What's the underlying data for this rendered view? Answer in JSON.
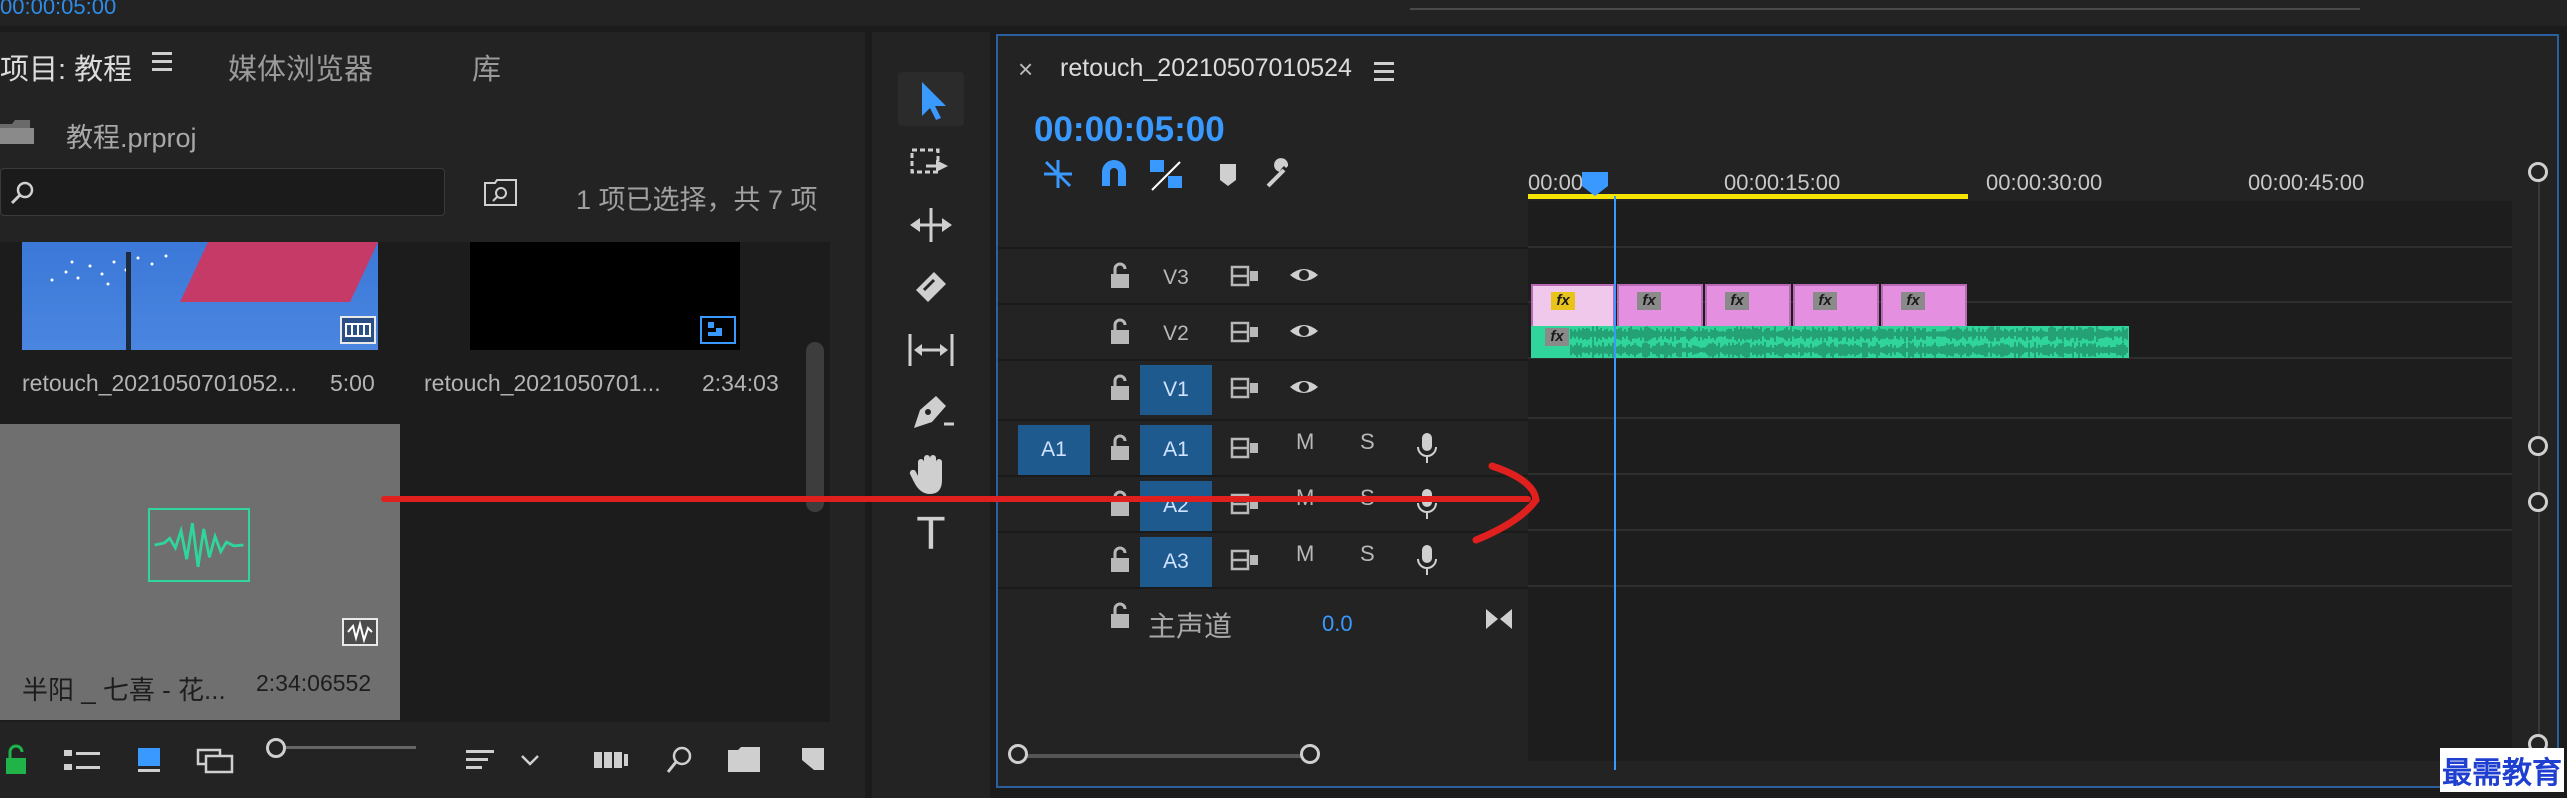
{
  "top": {
    "timecode": "00:00:05:00"
  },
  "project": {
    "tabs": [
      {
        "label": "项目: 教程"
      },
      {
        "label": "媒体浏览器"
      },
      {
        "label": "库"
      }
    ],
    "project_name": "教程.prproj",
    "search": {
      "placeholder": ""
    },
    "selection_info": "1 项已选择，共 7 项",
    "items": [
      {
        "name": "retouch_2021050701052...",
        "duration": "5:00"
      },
      {
        "name": "retouch_2021050701...",
        "duration": "2:34:03"
      },
      {
        "name": "半阳 _ 七喜 - 花...",
        "duration": "2:34:06552"
      }
    ]
  },
  "timeline": {
    "sequence_name": "retouch_20210507010524",
    "close_glyph": "×",
    "timecode": "00:00:05:00",
    "ruler_labels": [
      "00:00",
      "00:00:15:00",
      "00:00:30:00",
      "00:00:45:00"
    ],
    "video_tracks": [
      {
        "name": "V3",
        "targeted": false
      },
      {
        "name": "V2",
        "targeted": false
      },
      {
        "name": "V1",
        "targeted": true
      }
    ],
    "audio_tracks": [
      {
        "source": "A1",
        "name": "A1"
      },
      {
        "source": "",
        "name": "A2"
      },
      {
        "source": "",
        "name": "A3"
      }
    ],
    "mute_label": "M",
    "solo_label": "S",
    "master": {
      "label": "主声道",
      "value": "0.0"
    },
    "fx_label": "fx"
  },
  "tools": {
    "text_tool_glyph": "T"
  },
  "colors": {
    "accent_blue": "#3a99ff",
    "video_clip": "#e58fe0",
    "audio_clip": "#2fd59a",
    "work_area": "#f4e400",
    "annotation_red": "#e0201e"
  },
  "watermark": "最需教育"
}
